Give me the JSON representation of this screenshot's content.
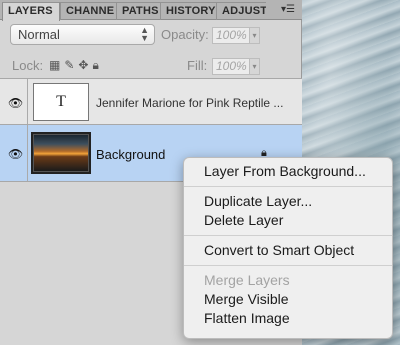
{
  "panel": {
    "tabs": [
      {
        "label": "LAYERS"
      },
      {
        "label": "CHANNE"
      },
      {
        "label": "PATHS"
      },
      {
        "label": "HISTORY"
      },
      {
        "label": "ADJUSTı"
      }
    ],
    "menu_icon": "panel-menu-icon",
    "blend_mode": "Normal",
    "opacity_label": "Opacity:",
    "opacity_value": "100%",
    "lock_label": "Lock:",
    "fill_label": "Fill:",
    "fill_value": "100%"
  },
  "layers": [
    {
      "name": "Jennifer Marione for Pink Reptile ...",
      "thumb_text": "T",
      "visible": true
    },
    {
      "name": "Background",
      "visible": true,
      "selected": true,
      "locked": true
    }
  ],
  "context_menu": {
    "group1": [
      "Layer From Background..."
    ],
    "group2": [
      "Duplicate Layer...",
      "Delete Layer"
    ],
    "group3": [
      "Convert to Smart Object"
    ],
    "group4": [
      {
        "label": "Merge Layers",
        "enabled": false
      },
      {
        "label": "Merge Visible",
        "enabled": true
      },
      {
        "label": "Flatten Image",
        "enabled": true
      }
    ]
  }
}
